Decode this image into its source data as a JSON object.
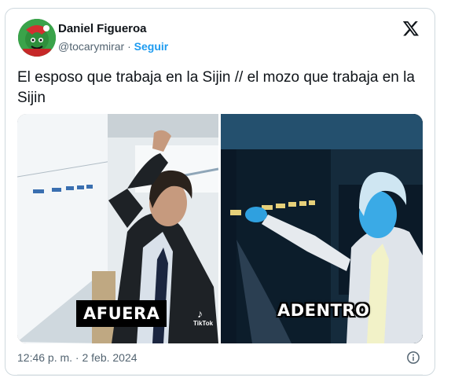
{
  "author": {
    "name": "Daniel Figueroa",
    "handle": "@tocarymirar",
    "separator": "·",
    "follow_label": "Seguir"
  },
  "tweet": {
    "text": "El esposo que trabaja en la Sijin // el mozo que trabaja en la Sijin"
  },
  "media": {
    "left_caption": "AFUERA",
    "right_caption": "ADENTRO",
    "watermark": "TikTok"
  },
  "footer": {
    "timestamp": "12:46 p. m. · 2 feb. 2024"
  },
  "colors": {
    "link": "#1d9bf0",
    "secondary_text": "#536471",
    "border": "#cfd9de"
  },
  "icons": {
    "brand": "x-logo-icon",
    "info": "info-icon"
  }
}
